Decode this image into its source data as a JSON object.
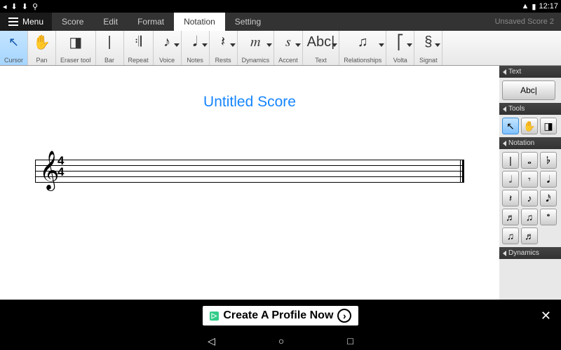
{
  "statusbar": {
    "time": "12:17"
  },
  "menubar": {
    "menu_label": "Menu",
    "items": [
      "Score",
      "Edit",
      "Format",
      "Notation",
      "Setting"
    ],
    "active_index": 3,
    "doc": "Unsaved Score 2"
  },
  "toolbar": [
    {
      "label": "Cursor",
      "icon": "↖",
      "drop": false,
      "sel": true
    },
    {
      "label": "Pan",
      "icon": "✋",
      "drop": false
    },
    {
      "label": "Eraser tool",
      "icon": "◨",
      "drop": false
    },
    {
      "label": "Bar",
      "icon": "|",
      "drop": false
    },
    {
      "label": "Repeat",
      "icon": "𝄇",
      "drop": false
    },
    {
      "label": "Voice",
      "icon": "♪",
      "drop": true
    },
    {
      "label": "Notes",
      "icon": "𝅘𝅥",
      "drop": true
    },
    {
      "label": "Rests",
      "icon": "𝄽",
      "drop": true
    },
    {
      "label": "Dynamics",
      "icon": "𝆐",
      "drop": true
    },
    {
      "label": "Accent",
      "icon": "𝆍",
      "drop": true
    },
    {
      "label": "Text",
      "icon": "Abc|",
      "drop": true
    },
    {
      "label": "Relationships",
      "icon": "♫",
      "drop": true
    },
    {
      "label": "Volta",
      "icon": "⎡",
      "drop": true
    },
    {
      "label": "Signat",
      "icon": "§",
      "drop": true
    }
  ],
  "score": {
    "title": "Untitled Score",
    "clef": "𝄞",
    "time_top": "4",
    "time_bot": "4"
  },
  "panels": {
    "text": {
      "title": "Text",
      "wide_label": "Abc|"
    },
    "tools": {
      "title": "Tools",
      "items": [
        "↖",
        "✋",
        "◨"
      ],
      "sel": 0
    },
    "notation": {
      "title": "Notation",
      "items": [
        "|",
        "𝅝",
        "𝄬",
        "𝅗𝅥",
        "𝄾",
        "𝅘𝅥",
        "𝄽",
        "♪",
        "𝅘𝅥𝅯",
        "♬",
        "♫",
        "𝆯",
        "♫",
        "♬"
      ]
    },
    "dynamics": {
      "title": "Dynamics"
    }
  },
  "ad": {
    "text": "Create A Profile Now"
  }
}
